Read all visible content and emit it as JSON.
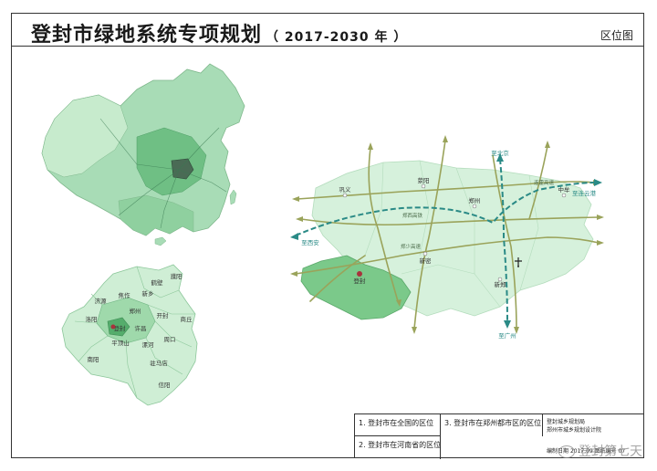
{
  "title": {
    "main": "登封市绿地系统专项规划",
    "years": "（ 2017-2030 年 ）"
  },
  "sheet_label": "区位图",
  "legend": {
    "item1": "1. 登封市在全国的区位",
    "item2": "2. 登封市在河南省的区位",
    "item3": "3. 登封市在郑州都市区的区位",
    "org": "登封城乡规划局",
    "org_sub": "郑州市城乡规划设计院",
    "date_label": "编制日期",
    "date_value": "2017.09",
    "drawing_no_label": "图纸编号",
    "drawing_no_value": "07"
  },
  "watermark": "登封第七天",
  "henan_labels": {
    "hebi": "鹤壁",
    "xinxiang": "新乡",
    "puyang": "濮阳",
    "jiaozuo": "焦作",
    "jiyuan": "济源",
    "kaifeng": "开封",
    "luoyang": "洛阳",
    "zhengzhou": "郑州",
    "shangqiu": "商丘",
    "dengfeng": "登封",
    "xuchang": "许昌",
    "zhoukou": "周口",
    "pingdingshan": "平顶山",
    "luohe": "漯河",
    "zhumadian": "驻马店",
    "nanyang": "南阳",
    "xinyang": "信阳"
  },
  "zhengzhou_labels": {
    "gongyi": "巩义",
    "xingyang": "荥阳",
    "zhengzhou": "郑州",
    "zhongmou": "中牟",
    "xinzheng": "新郑",
    "xinmi": "新密",
    "dengfeng": "登封",
    "to_beijing": "至北京",
    "to_guangzhou": "至广州",
    "to_xian": "至西安",
    "to_lianyungang": "至连云港",
    "highway_lianhuo": "连霍高速",
    "highway_zhengxi": "郑西高铁",
    "highway_zhengshao": "郑少高速"
  },
  "colors": {
    "china_base": "#a8dcb6",
    "china_light": "#c7ebcd",
    "china_dark": "#6fbf84",
    "henan_light": "#cfeed5",
    "henan_mid": "#9fd9ab",
    "henan_dark": "#55ad6c",
    "metro_base": "#d6f1dc",
    "dengfeng_area": "#7bc98a",
    "road": "#9aa35a",
    "rail": "#2a8a86",
    "marker": "#a8323c"
  }
}
